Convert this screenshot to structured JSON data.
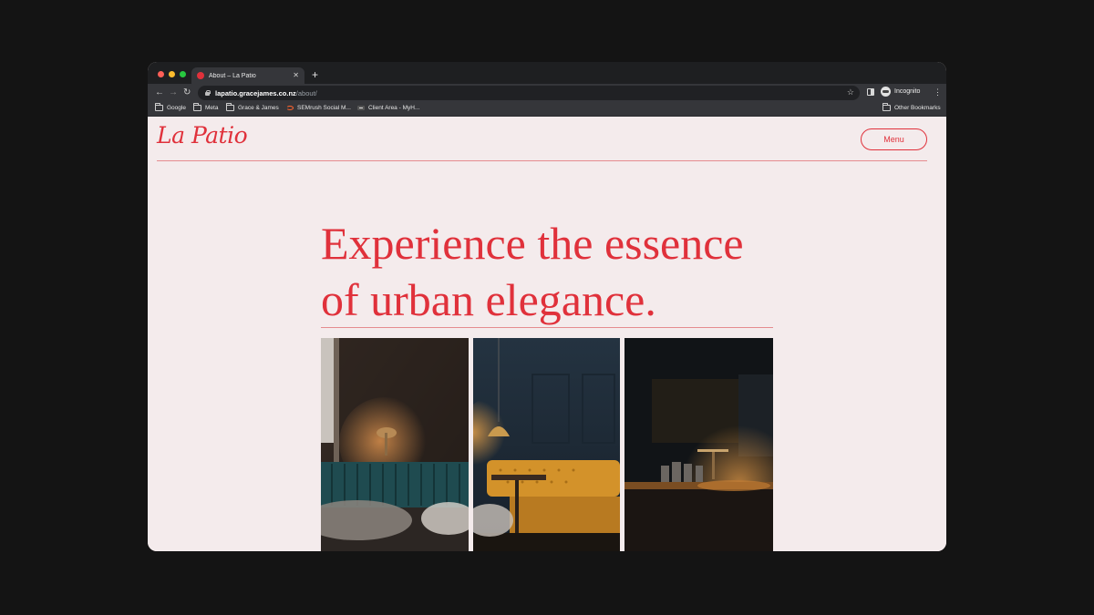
{
  "browser": {
    "tab_title": "About – La Patio",
    "new_tab_label": "+",
    "url_host": "lapatio.gracejames.co.nz",
    "url_path": "/about/",
    "profile_label": "Incognito",
    "icons": [
      "back-arrow-icon",
      "forward-arrow-icon",
      "reload-icon",
      "lock-icon",
      "star-icon",
      "side-panel-icon",
      "incognito-icon",
      "kebab-menu-icon",
      "folder-icon",
      "semrush-icon",
      "client-area-icon"
    ],
    "traffic_lights": {
      "close": "#ff5f57",
      "minimize": "#febc2e",
      "maximize": "#28c840"
    }
  },
  "bookmarks": {
    "items": [
      {
        "label": "Google"
      },
      {
        "label": "Meta"
      },
      {
        "label": "Grace & James"
      },
      {
        "label": "SEMrush Social M..."
      },
      {
        "label": "Client Area - MyH..."
      }
    ],
    "other": "Other Bookmarks"
  },
  "site": {
    "logo": "La Patio",
    "menu_label": "Menu",
    "headline": "Experience the essence of urban elegance.",
    "accent": "#e0313b",
    "background": "#f4ebec",
    "images": [
      "Restaurant interior with teal velvet booth, brass lamp and window",
      "Dark blue room with mustard leather booth and pendant lamp",
      "Dimly lit bar counter with lamp and glassware"
    ]
  }
}
